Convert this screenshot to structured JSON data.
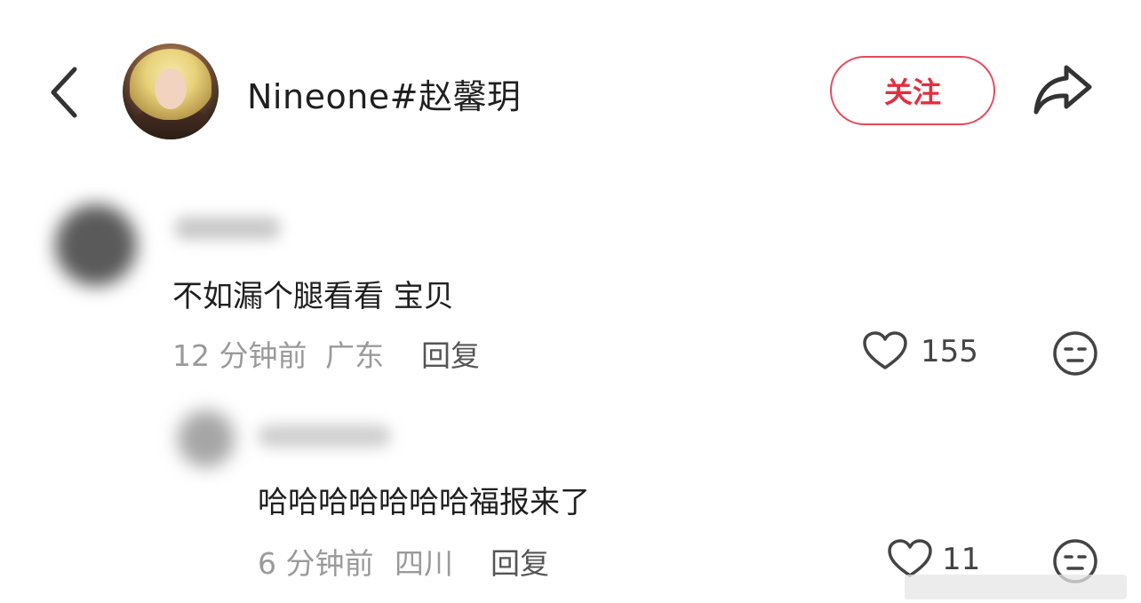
{
  "header": {
    "username": "Nineone#赵馨玥",
    "follow_label": "关注"
  },
  "comments": [
    {
      "text": "不如漏个腿看看 宝贝",
      "time": "12 分钟前",
      "location": "广东",
      "reply_label": "回复",
      "likes": "155"
    },
    {
      "text": "哈哈哈哈哈哈哈福报来了",
      "time": "6 分钟前",
      "location": "四川",
      "reply_label": "回复",
      "likes": "11"
    }
  ],
  "icons": {
    "back": "chevron-left-icon",
    "share": "share-arrow-icon",
    "like": "heart-outline-icon",
    "emoji": "face-icon"
  },
  "colors": {
    "accent": "#e64a5b",
    "meta": "#9a9a9a"
  }
}
